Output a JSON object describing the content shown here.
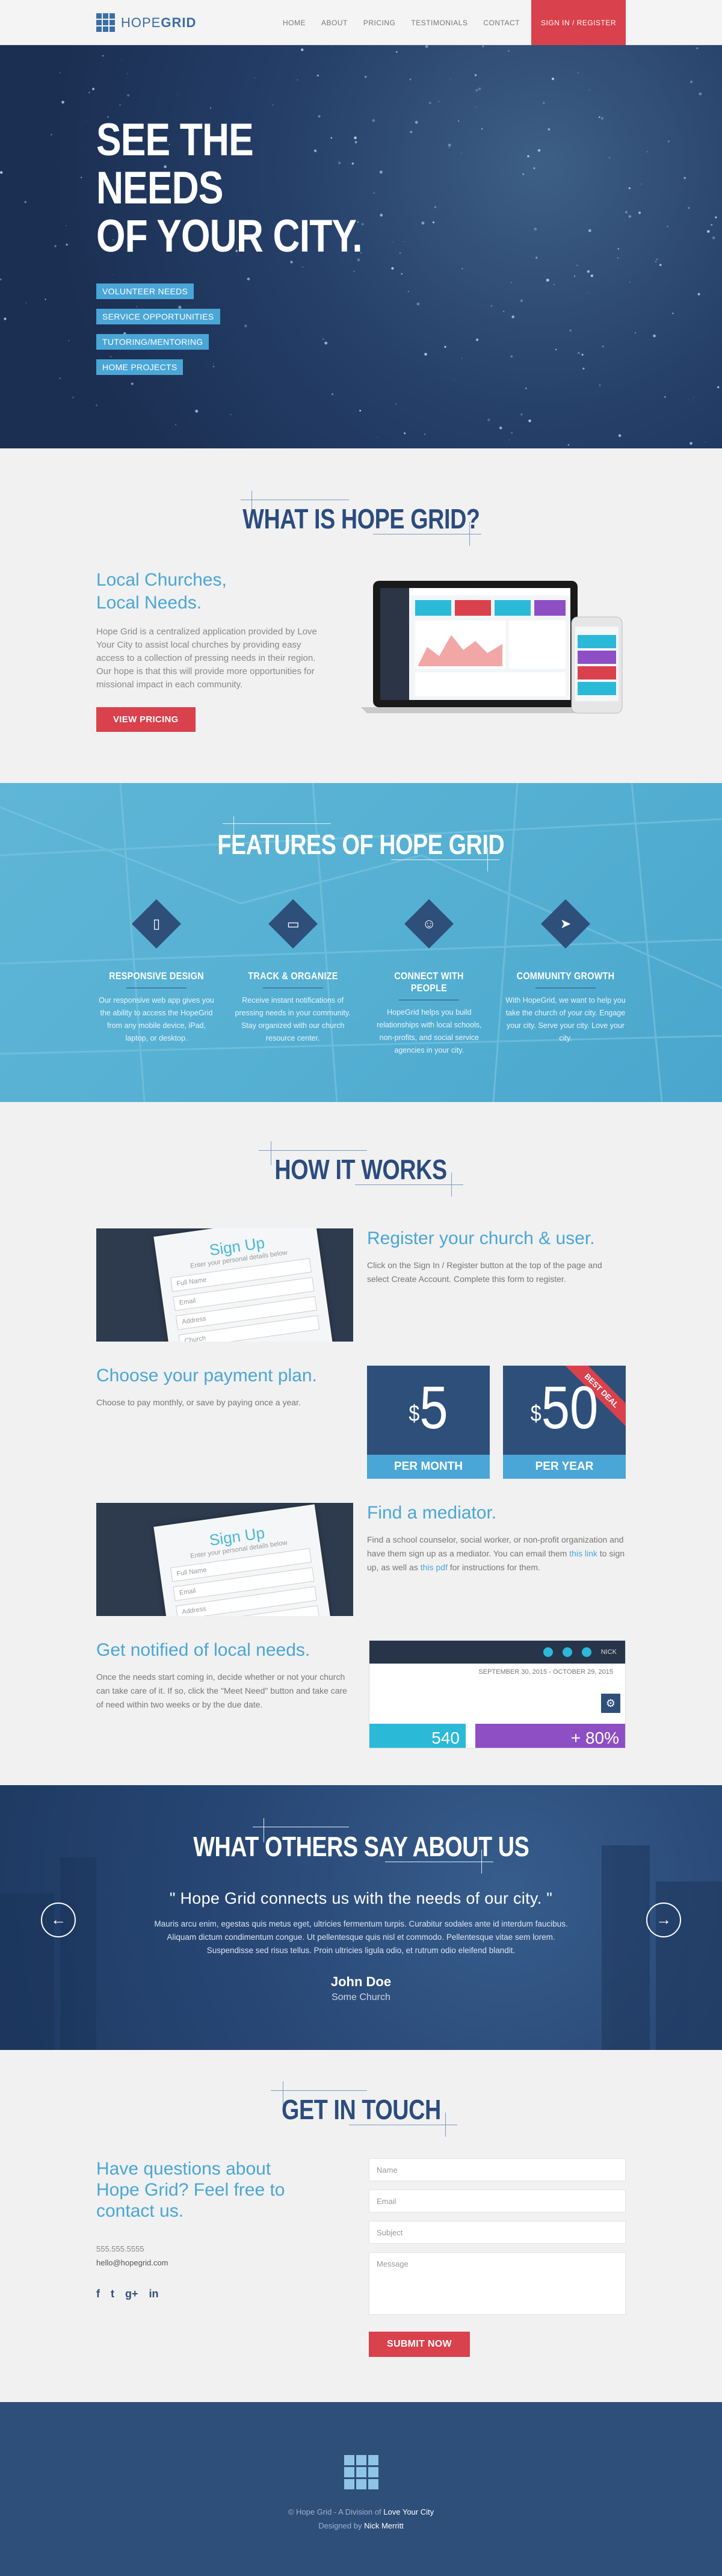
{
  "nav": {
    "logo_light": "HOPE",
    "logo_bold": "GRID",
    "items": [
      "HOME",
      "ABOUT",
      "PRICING",
      "TESTIMONIALS",
      "CONTACT"
    ],
    "signin": "SIGN IN / REGISTER"
  },
  "hero": {
    "title_line1": "SEE THE NEEDS",
    "title_line2": "OF YOUR CITY.",
    "tags": [
      "VOLUNTEER NEEDS",
      "SERVICE OPPORTUNITIES",
      "TUTORING/MENTORING",
      "HOME PROJECTS"
    ]
  },
  "what": {
    "heading": "WHAT IS HOPE GRID?",
    "subtitle_line1": "Local Churches,",
    "subtitle_line2": "Local Needs.",
    "body": "Hope Grid is a centralized application provided by Love Your City to assist local churches by providing easy access to a collection of pressing needs in their region. Our hope is that this will provide more opportunities for missional impact in each community.",
    "button": "VIEW PRICING"
  },
  "features": {
    "heading": "FEATURES OF HOPE GRID",
    "items": [
      {
        "title": "RESPONSIVE DESIGN",
        "icon": "tablet-icon",
        "text": "Our responsive web app gives you the ability to access the HopeGrid from any mobile device, iPad, laptop, or desktop."
      },
      {
        "title": "TRACK & ORGANIZE",
        "icon": "laptop-icon",
        "text": "Receive instant notifications of pressing needs in your community. Stay organized with our church resource center."
      },
      {
        "title": "CONNECT WITH PEOPLE",
        "icon": "user-icon",
        "text": "HopeGrid helps you build relationships with local schools, non-profits, and social service agencies in your city."
      },
      {
        "title": "COMMUNITY GROWTH",
        "icon": "paper-plane-icon",
        "text": "With HopeGrid, we want to help you take the church of your city. Engage your city. Serve your city. Love your city."
      }
    ]
  },
  "how": {
    "heading": "HOW IT WORKS",
    "step1": {
      "title": "Register your church & user.",
      "text": "Click on the Sign In / Register button at the top of the page and select Create Account. Complete this form to register."
    },
    "step2": {
      "title": "Choose your payment plan.",
      "text": "Choose to pay monthly, or save by paying once a year."
    },
    "step3": {
      "title": "Find a mediator.",
      "text_a": "Find a school counselor, social worker, or non-profit organization and have them sign up as a mediator. You can email them ",
      "link1": "this link",
      "text_b": " to sign up, as well as ",
      "link2": "this pdf",
      "text_c": " for instructions for them."
    },
    "step4": {
      "title": "Get notified of local needs.",
      "text": "Once the needs start coming in, decide whether or not your church can take care of it. If so, click the \"Meet Need\" button and take care of need within two weeks or by the due date."
    },
    "signup": {
      "title": "Sign Up",
      "sub": "Enter your personal details below",
      "fields": [
        "Full Name",
        "Email",
        "Address",
        "Church"
      ]
    },
    "price_monthly": {
      "currency": "$",
      "amount": "5",
      "label": "PER MONTH"
    },
    "price_yearly": {
      "currency": "$",
      "amount": "50",
      "label": "PER YEAR",
      "ribbon": "BEST DEAL"
    },
    "dash": {
      "user": "NICK",
      "date": "SEPTEMBER 30, 2015 - OCTOBER 29, 2015",
      "tile1": "540",
      "tile2": "+ 80%"
    }
  },
  "testimonials": {
    "heading": "WHAT OTHERS SAY ABOUT US",
    "quote": "\" Hope Grid connects us with the needs of our city. \"",
    "body": "Mauris arcu enim, egestas quis metus eget, ultricies fermentum turpis. Curabitur sodales ante id interdum faucibus. Aliquam dictum condimentum congue. Ut pellentesque quis nisl et commodo. Pellentesque vitae sem lorem. Suspendisse sed risus tellus. Proin ultricies ligula odio, et rutrum odio eleifend blandit.",
    "name": "John Doe",
    "org": "Some Church",
    "prev": "←",
    "next": "→"
  },
  "contact": {
    "heading": "GET IN TOUCH",
    "title": "Have questions about Hope Grid? Feel free to contact us.",
    "phone": "555.555.5555",
    "email": "hello@hopegrid.com",
    "socials": [
      "f",
      "t",
      "g+",
      "in"
    ],
    "ph_name": "Name",
    "ph_email": "Email",
    "ph_subject": "Subject",
    "ph_message": "Message",
    "submit": "SUBMIT NOW"
  },
  "footer": {
    "line1_a": "© Hope Grid - A Division of ",
    "line1_link": "Love Your City",
    "line2_a": "Designed by ",
    "line2_link": "Nick Merritt"
  },
  "colors": {
    "navy": "#2e4f7a",
    "blue": "#4aa6d6",
    "red": "#d9414c"
  }
}
